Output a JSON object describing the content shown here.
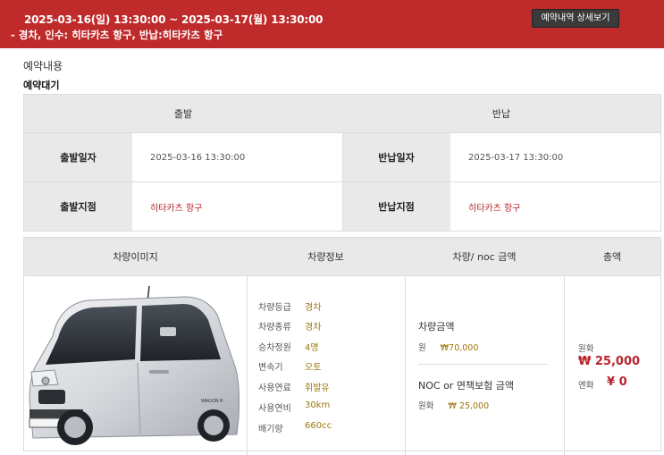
{
  "banner": {
    "dates": "2025-03-16(일) 13:30:00 ~ 2025-03-17(월) 13:30:00",
    "route": "- 경차, 인수: 히타카츠 항구, 반납:히타카츠 항구",
    "detail_button": "예약내역 상세보기"
  },
  "section": {
    "title": "예약내용",
    "status": "예약대기"
  },
  "schedule": {
    "departure_header": "출발",
    "return_header": "반납",
    "departure_date_label": "출발일자",
    "departure_date": "2025-03-16 13:30:00",
    "return_date_label": "반납일자",
    "return_date": "2025-03-17 13:30:00",
    "departure_place_label": "출발지점",
    "departure_place": "히타카츠 항구",
    "return_place_label": "반납지점",
    "return_place": "히타카츠 항구"
  },
  "vehicle": {
    "headers": {
      "image": "차량이미지",
      "info": "차량정보",
      "price": "차량/ noc 금액",
      "total": "총액"
    },
    "image_badge": "WAGON R",
    "specs": [
      {
        "label": "차량등급",
        "value": "경차"
      },
      {
        "label": "차량종류",
        "value": "경차"
      },
      {
        "label": "승차정원",
        "value": "4명"
      },
      {
        "label": "변속기",
        "value": "오토"
      },
      {
        "label": "사용연료",
        "value": "휘발유"
      },
      {
        "label": "사용연비",
        "value": "30km"
      },
      {
        "label": "배기량",
        "value": "660cc"
      }
    ],
    "car_price_title": "차량금액",
    "car_price_unit": "원",
    "car_price_amount": "₩70,000",
    "noc_title": "NOC or 면책보험 금액",
    "noc_unit": "원화",
    "noc_amount": "₩ 25,000",
    "total_krw_label": "원화",
    "total_krw": "₩ 25,000",
    "total_jpy_label": "엔화",
    "total_jpy": "¥ 0"
  },
  "colors": {
    "banner": "#bf2a2a",
    "accent_red": "#b8232b",
    "accent_gold": "#a0760a",
    "header_gray": "#e9e9e9"
  }
}
